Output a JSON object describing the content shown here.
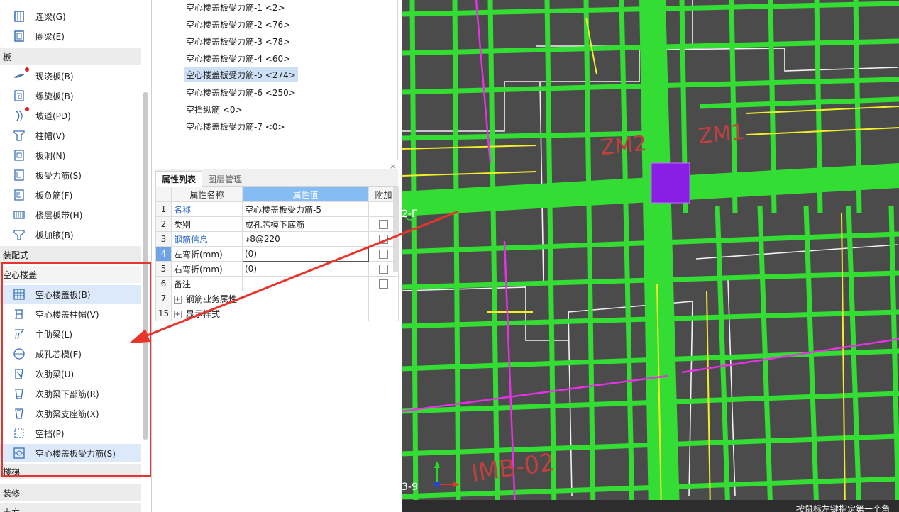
{
  "sidebar": {
    "items_top": [
      {
        "label": "连梁(G)",
        "icon": "coupling-beam-icon"
      },
      {
        "label": "圈梁(E)",
        "icon": "ring-beam-icon"
      }
    ],
    "category_slab": "板",
    "slab_items": [
      {
        "label": "现浇板(B)",
        "icon": "cast-slab-icon",
        "badge": true
      },
      {
        "label": "螺旋板(B)",
        "icon": "spiral-slab-icon",
        "badge": false
      },
      {
        "label": "坡道(PD)",
        "icon": "ramp-icon",
        "badge": true
      },
      {
        "label": "柱帽(V)",
        "icon": "column-cap-icon",
        "badge": false
      },
      {
        "label": "板洞(N)",
        "icon": "slab-hole-icon",
        "badge": false
      },
      {
        "label": "板受力筋(S)",
        "icon": "slab-rebar-icon",
        "badge": false
      },
      {
        "label": "板负筋(F)",
        "icon": "slab-negative-rebar-icon",
        "badge": false
      },
      {
        "label": "楼层板带(H)",
        "icon": "floor-strip-icon",
        "badge": false
      },
      {
        "label": "板加腋(B)",
        "icon": "slab-haunch-icon",
        "badge": false
      }
    ],
    "category_assembly": "装配式",
    "category_hollow": "空心楼盖",
    "hollow_items": [
      {
        "label": "空心楼盖板(B)",
        "icon": "hollow-slab-icon",
        "selected": true
      },
      {
        "label": "空心楼盖柱帽(V)",
        "icon": "hollow-column-cap-icon",
        "selected": false
      },
      {
        "label": "主肋梁(L)",
        "icon": "main-rib-beam-icon",
        "selected": false
      },
      {
        "label": "成孔芯模(E)",
        "icon": "hole-core-mold-icon",
        "selected": false
      },
      {
        "label": "次肋梁(U)",
        "icon": "secondary-rib-beam-icon",
        "selected": false
      },
      {
        "label": "次肋梁下部筋(R)",
        "icon": "rib-bottom-rebar-icon",
        "selected": false
      },
      {
        "label": "次肋梁支座筋(X)",
        "icon": "rib-support-rebar-icon",
        "selected": false
      },
      {
        "label": "空挡(P)",
        "icon": "gap-icon",
        "selected": false
      },
      {
        "label": "空心楼盖板受力筋(S)",
        "icon": "hollow-slab-rebar-icon",
        "selected": true
      }
    ],
    "category_stairs": "楼梯",
    "category_decoration": "装修",
    "category_earthwork": "土方"
  },
  "rebar_list": [
    {
      "label": "空心楼盖板受力筋-1 <2>",
      "selected": false
    },
    {
      "label": "空心楼盖板受力筋-2 <76>",
      "selected": false
    },
    {
      "label": "空心楼盖板受力筋-3 <78>",
      "selected": false
    },
    {
      "label": "空心楼盖板受力筋-4 <60>",
      "selected": false
    },
    {
      "label": "空心楼盖板受力筋-5 <274>",
      "selected": true
    },
    {
      "label": "空心楼盖板受力筋-6 <250>",
      "selected": false
    },
    {
      "label": "空挡纵筋 <0>",
      "selected": false
    },
    {
      "label": "空心楼盖板受力筋-7 <0>",
      "selected": false
    }
  ],
  "property_panel": {
    "close_glyph": "×",
    "tabs": [
      "属性列表",
      "图层管理"
    ],
    "headers": {
      "name": "属性名称",
      "value": "属性值",
      "extra": "附加"
    },
    "rows": [
      {
        "idx": "1",
        "name": "名称",
        "value": "空心楼盖板受力筋-5",
        "checkbox": false,
        "blue": true
      },
      {
        "idx": "2",
        "name": "类别",
        "value": "成孔芯模下底筋",
        "checkbox": true,
        "blue": false
      },
      {
        "idx": "3",
        "name": "钢筋信息",
        "value": "⌽8@220",
        "checkbox": true,
        "blue": true
      },
      {
        "idx": "4",
        "name": "左弯折(mm)",
        "value": "(0)",
        "checkbox": true,
        "blue": false
      },
      {
        "idx": "5",
        "name": "右弯折(mm)",
        "value": "(0)",
        "checkbox": true,
        "blue": false
      },
      {
        "idx": "6",
        "name": "备注",
        "value": "",
        "checkbox": true,
        "blue": false
      },
      {
        "idx": "7",
        "name": "钢筋业务属性",
        "value": "",
        "checkbox": false,
        "blue": false,
        "group": true
      },
      {
        "idx": "15",
        "name": "显示样式",
        "value": "",
        "checkbox": false,
        "blue": false,
        "group": true
      }
    ]
  },
  "cad": {
    "labels": {
      "zm2": "ZM2",
      "zm1": "ZM1",
      "axis_f": "2-F",
      "axis_9": "3-9",
      "imb": "IMB-02"
    },
    "status_hint": "按鼠标左键指定第一个角",
    "colors": {
      "background": "#4b4b4b",
      "rib": "#33dd33",
      "yellow": "#f1ee2a",
      "magenta": "#e532e5",
      "white": "#f2f2f2",
      "column": "#8a1ee6",
      "annotation": "#e8352b"
    }
  }
}
